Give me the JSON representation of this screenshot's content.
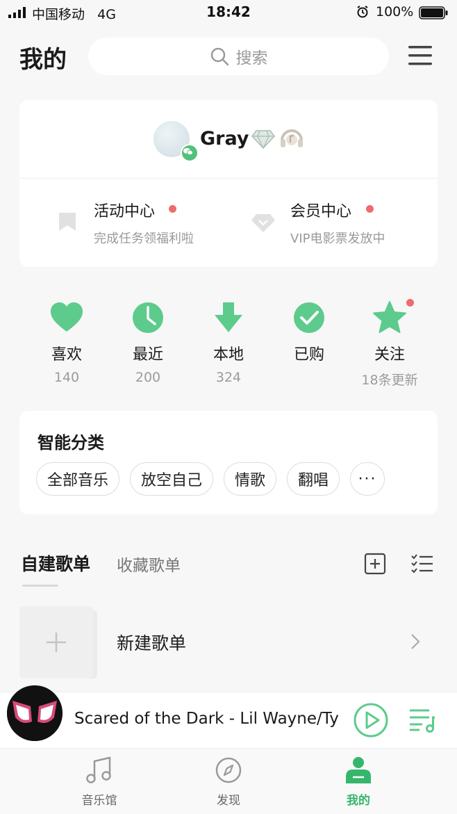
{
  "status_bar": {
    "carrier": "中国移动",
    "network": "4G",
    "time": "18:42",
    "battery": "100%"
  },
  "header": {
    "title": "我的",
    "search_placeholder": "搜索"
  },
  "profile": {
    "username": "Gray",
    "activity": {
      "title": "活动中心",
      "subtitle": "完成任务领福利啦"
    },
    "vip": {
      "title": "会员中心",
      "subtitle": "VIP电影票发放中"
    }
  },
  "quick_actions": [
    {
      "label": "喜欢",
      "count": "140",
      "icon": "heart-icon"
    },
    {
      "label": "最近",
      "count": "200",
      "icon": "clock-icon"
    },
    {
      "label": "本地",
      "count": "324",
      "icon": "download-icon"
    },
    {
      "label": "已购",
      "count": "",
      "icon": "check-circle-icon"
    },
    {
      "label": "关注",
      "count": "18条更新",
      "icon": "star-icon"
    }
  ],
  "smart_category": {
    "title": "智能分类",
    "chips": [
      "全部音乐",
      "放空自己",
      "情歌",
      "翻唱"
    ],
    "more": "···"
  },
  "playlist_tabs": {
    "created": "自建歌单",
    "favorited": "收藏歌单"
  },
  "new_playlist": {
    "label": "新建歌单"
  },
  "mini_player": {
    "now_playing": "Scared of the Dark - Lil Wayne/Ty Dolla $ign/XXXTENTACION"
  },
  "tab_bar": [
    {
      "label": "音乐馆",
      "active": false
    },
    {
      "label": "发现",
      "active": false
    },
    {
      "label": "我的",
      "active": true
    }
  ],
  "colors": {
    "accent": "#5ccb8c",
    "active_tab": "#36b66c",
    "dot": "#ef6c6c",
    "background": "#f7f7f7"
  }
}
